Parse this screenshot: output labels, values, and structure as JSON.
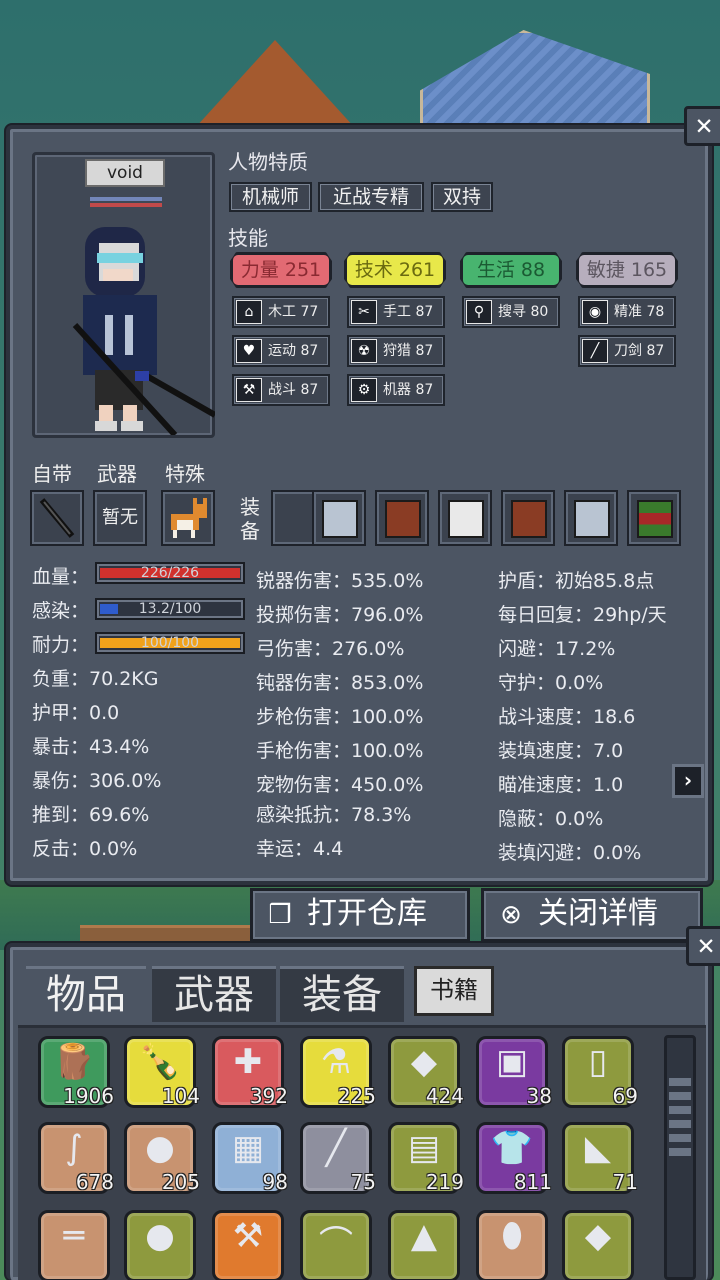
{
  "character": {
    "name": "void",
    "traits_title": "人物特质",
    "traits": [
      "机械师",
      "近战专精",
      "双持"
    ],
    "skills_title": "技能",
    "main_skills": [
      {
        "label": "力量 251",
        "color": "#e26a73"
      },
      {
        "label": "技术 261",
        "color": "#e8e84a"
      },
      {
        "label": "生活 88",
        "color": "#48b46f"
      },
      {
        "label": "敏捷 165",
        "color": "#b7aebd"
      }
    ],
    "sub_skills": [
      {
        "icon": "house-icon",
        "glyph": "⌂",
        "label": "木工 77"
      },
      {
        "icon": "scissors-icon",
        "glyph": "✂",
        "label": "手工 87"
      },
      {
        "icon": "magnifier-icon",
        "glyph": "⚲",
        "label": "搜寻 80"
      },
      {
        "icon": "eye-icon",
        "glyph": "◉",
        "label": "精准 78"
      },
      {
        "icon": "heart-icon",
        "glyph": "♥",
        "label": "运动 87"
      },
      {
        "icon": "radiation-icon",
        "glyph": "☢",
        "label": "狩猎 87"
      },
      {
        "icon": "blade-icon",
        "glyph": "╱",
        "label": "刀剑 87"
      },
      {
        "icon": "axe-icon",
        "glyph": "⚒",
        "label": "战斗 87"
      },
      {
        "icon": "gear-icon",
        "glyph": "⚙",
        "label": "机器 87"
      }
    ]
  },
  "slots": {
    "self_label": "自带",
    "weapon_label": "武器",
    "special_label": "特殊",
    "weapon_value": "暂无",
    "equip_label": "装备"
  },
  "equipment": [
    "empty",
    "scissor-card",
    "book-red",
    "paper-sheet",
    "book-red",
    "scissor-card",
    "books-stack"
  ],
  "stats_left": [
    {
      "label": "血量：",
      "bar": "226/226",
      "fill": 1.0,
      "color": "#d0312d"
    },
    {
      "label": "感染：",
      "bar": "13.2/100",
      "fill": 0.132,
      "color": "#2f5ccc"
    },
    {
      "label": "耐力：",
      "bar": "100/100",
      "fill": 1.0,
      "color": "#f1a21b"
    },
    {
      "label": "负重：70.2KG"
    },
    {
      "label": "护甲：0.0"
    },
    {
      "label": "暴击：43.4%"
    },
    {
      "label": "暴伤：306.0%"
    },
    {
      "label": "推到：69.6%"
    },
    {
      "label": "反击：0.0%"
    }
  ],
  "stats_mid": [
    "锐器伤害：535.0%",
    "投掷伤害：796.0%",
    "弓伤害：276.0%",
    "钝器伤害：853.0%",
    "步枪伤害：100.0%",
    "手枪伤害：100.0%",
    "宠物伤害：450.0%",
    "感染抵抗：78.3%",
    "幸运：4.4"
  ],
  "stats_right": [
    "护盾：初始85.8点",
    "每日回复：29hp/天",
    "闪避：17.2%",
    "守护：0.0%",
    "战斗速度：18.6",
    "装填速度：7.0",
    "瞄准速度：1.0",
    "隐蔽：0.0%",
    "装填闪避：0.0%"
  ],
  "buttons": {
    "open_storage": "打开仓库",
    "close_detail": "关闭详情",
    "close_glyph": "✕",
    "arrow_glyph": "›"
  },
  "inventory": {
    "tabs": [
      "物品",
      "武器",
      "装备"
    ],
    "book_tab": "书籍",
    "items": [
      {
        "name": "wood-log",
        "glyph": "🪵",
        "count": "1906",
        "bg": "#3f9a5d"
      },
      {
        "name": "bottle",
        "glyph": "🍾",
        "count": "104",
        "bg": "#e6dc3c"
      },
      {
        "name": "medkit",
        "glyph": "✚",
        "count": "392",
        "bg": "#d95a5e"
      },
      {
        "name": "potion",
        "glyph": "⚗",
        "count": "225",
        "bg": "#e6dc3c"
      },
      {
        "name": "meat-can",
        "glyph": "◆",
        "count": "424",
        "bg": "#8e9a3e"
      },
      {
        "name": "energy-cell",
        "glyph": "▣",
        "count": "38",
        "bg": "#7a3aa0"
      },
      {
        "name": "milk-bottle",
        "glyph": "▯",
        "count": "69",
        "bg": "#8e9a3e"
      },
      {
        "name": "wire",
        "glyph": "∫",
        "count": "678",
        "bg": "#c89370"
      },
      {
        "name": "stone",
        "glyph": "●",
        "count": "205",
        "bg": "#c89370"
      },
      {
        "name": "circuit-board",
        "glyph": "▦",
        "count": "98",
        "bg": "#8fb0d6"
      },
      {
        "name": "tube",
        "glyph": "╱",
        "count": "75",
        "bg": "#8e8f9e"
      },
      {
        "name": "chocolate",
        "glyph": "▤",
        "count": "219",
        "bg": "#8e9a3e"
      },
      {
        "name": "shirt",
        "glyph": "👕",
        "count": "811",
        "bg": "#7a3aa0"
      },
      {
        "name": "boots",
        "glyph": "◣",
        "count": "71",
        "bg": "#8e9a3e"
      },
      {
        "name": "rifle",
        "glyph": "═",
        "count": "",
        "bg": "#c89370"
      },
      {
        "name": "apple",
        "glyph": "●",
        "count": "",
        "bg": "#8e9a3e"
      },
      {
        "name": "wrench",
        "glyph": "⚒",
        "count": "",
        "bg": "#e07a2e"
      },
      {
        "name": "chili",
        "glyph": "⌒",
        "count": "",
        "bg": "#8e9a3e"
      },
      {
        "name": "spray",
        "glyph": "▲",
        "count": "",
        "bg": "#8e9a3e"
      },
      {
        "name": "egg",
        "glyph": "⬮",
        "count": "",
        "bg": "#c89370"
      },
      {
        "name": "steak",
        "glyph": "◆",
        "count": "",
        "bg": "#8e9a3e"
      }
    ]
  }
}
